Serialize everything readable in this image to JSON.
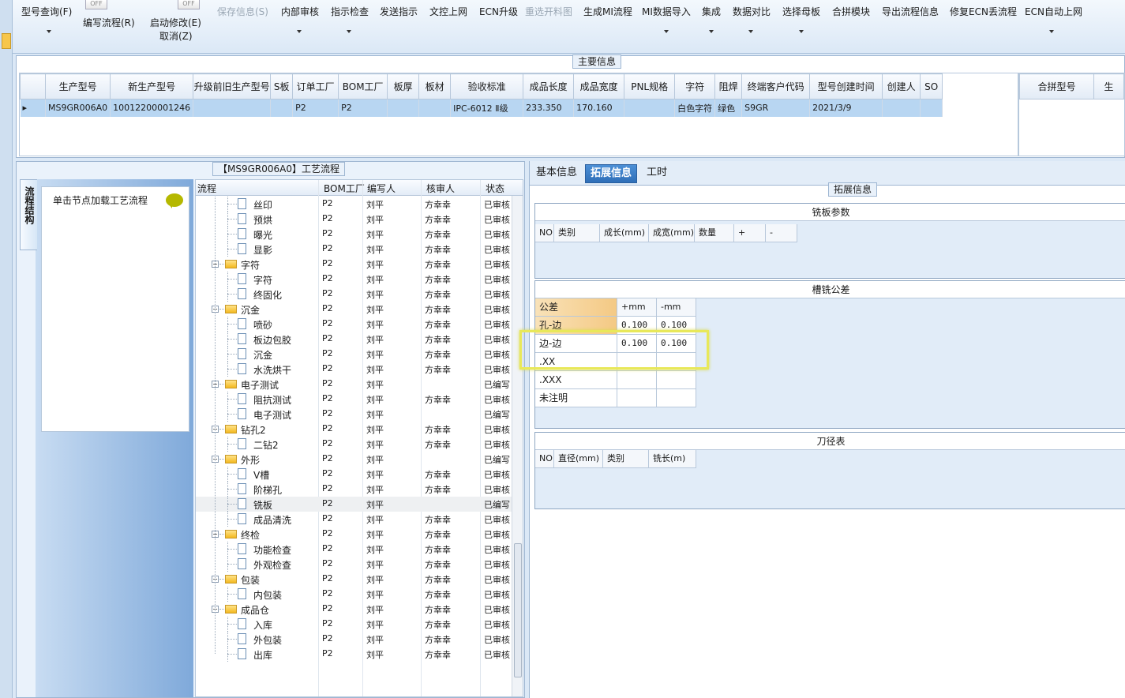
{
  "toolbar": {
    "items": [
      {
        "label": "型号查询(F)",
        "enabled": true,
        "dropdown": true
      },
      {
        "label": "编写流程(R)",
        "enabled": true,
        "toggle": "OFF"
      },
      {
        "label": "启动修改(E)",
        "enabled": true,
        "toggle": "OFF"
      },
      {
        "label": "取消(Z)",
        "enabled": true
      },
      {
        "label": "保存信息(S)",
        "enabled": false
      },
      {
        "label": "内部审核",
        "enabled": true,
        "dropdown": true
      },
      {
        "label": "指示检查",
        "enabled": true,
        "dropdown": true
      },
      {
        "label": "发送指示",
        "enabled": true
      },
      {
        "label": "文控上网",
        "enabled": true
      },
      {
        "label": "ECN升级",
        "enabled": true
      },
      {
        "label": "重选开料图",
        "enabled": false
      },
      {
        "label": "生成MI流程",
        "enabled": true
      },
      {
        "label": "MI数据导入",
        "enabled": true,
        "dropdown": true
      },
      {
        "label": "集成",
        "enabled": true,
        "dropdown": true
      },
      {
        "label": "数据对比",
        "enabled": true,
        "dropdown": true
      },
      {
        "label": "选择母板",
        "enabled": true,
        "dropdown": true
      },
      {
        "label": "合拼模块",
        "enabled": true
      },
      {
        "label": "导出流程信息",
        "enabled": true
      },
      {
        "label": "修复ECN丢流程",
        "enabled": true
      },
      {
        "label": "ECN自动上网",
        "enabled": true,
        "dropdown": true
      }
    ]
  },
  "main_info": {
    "title": "主要信息",
    "columns": [
      "生产型号",
      "新生产型号",
      "升级前旧生产型号",
      "S板",
      "订单工厂",
      "BOM工厂",
      "板厚",
      "板材",
      "验收标准",
      "成品长度",
      "成品宽度",
      "PNL规格",
      "字符",
      "阻焊",
      "终端客户代码",
      "型号创建时间",
      "创建人",
      "SO"
    ],
    "rows": [
      [
        "MS9GR006A0",
        "10012200001246",
        "",
        "",
        "P2",
        "P2",
        "",
        "",
        "IPC-6012 Ⅱ级",
        "233.350",
        "170.160",
        "",
        "白色字符",
        "绿色",
        "S9GR",
        "2021/3/9",
        "",
        ""
      ]
    ],
    "right_columns": [
      "合拼型号",
      "生"
    ]
  },
  "flow": {
    "title": "【MS9GR006A0】工艺流程",
    "side_tab": "流程结构",
    "node_hint": "单击节点加载工艺流程",
    "columns": [
      "流程",
      "BOM工厂",
      "编写人",
      "核审人",
      "状态"
    ],
    "rows": [
      {
        "name": "丝印",
        "type": "doc",
        "bom": "P2",
        "writer": "刘平",
        "reviewer": "方幸幸",
        "status": "已审核"
      },
      {
        "name": "预烘",
        "type": "doc",
        "bom": "P2",
        "writer": "刘平",
        "reviewer": "方幸幸",
        "status": "已审核"
      },
      {
        "name": "曝光",
        "type": "doc",
        "bom": "P2",
        "writer": "刘平",
        "reviewer": "方幸幸",
        "status": "已审核"
      },
      {
        "name": "显影",
        "type": "doc",
        "bom": "P2",
        "writer": "刘平",
        "reviewer": "方幸幸",
        "status": "已审核"
      },
      {
        "name": "字符",
        "type": "folder",
        "bom": "P2",
        "writer": "刘平",
        "reviewer": "方幸幸",
        "status": "已审核"
      },
      {
        "name": "字符",
        "type": "doc",
        "bom": "P2",
        "writer": "刘平",
        "reviewer": "方幸幸",
        "status": "已审核"
      },
      {
        "name": "终固化",
        "type": "doc",
        "bom": "P2",
        "writer": "刘平",
        "reviewer": "方幸幸",
        "status": "已审核"
      },
      {
        "name": "沉金",
        "type": "folder",
        "bom": "P2",
        "writer": "刘平",
        "reviewer": "方幸幸",
        "status": "已审核"
      },
      {
        "name": "喷砂",
        "type": "doc",
        "bom": "P2",
        "writer": "刘平",
        "reviewer": "方幸幸",
        "status": "已审核"
      },
      {
        "name": "板边包胶",
        "type": "doc",
        "bom": "P2",
        "writer": "刘平",
        "reviewer": "方幸幸",
        "status": "已审核"
      },
      {
        "name": "沉金",
        "type": "doc",
        "bom": "P2",
        "writer": "刘平",
        "reviewer": "方幸幸",
        "status": "已审核"
      },
      {
        "name": "水洗烘干",
        "type": "doc",
        "bom": "P2",
        "writer": "刘平",
        "reviewer": "方幸幸",
        "status": "已审核"
      },
      {
        "name": "电子测试",
        "type": "folder",
        "bom": "P2",
        "writer": "刘平",
        "reviewer": "",
        "status": "已编写"
      },
      {
        "name": "阻抗测试",
        "type": "doc",
        "bom": "P2",
        "writer": "刘平",
        "reviewer": "方幸幸",
        "status": "已审核"
      },
      {
        "name": "电子测试",
        "type": "doc",
        "bom": "P2",
        "writer": "刘平",
        "reviewer": "",
        "status": "已编写"
      },
      {
        "name": "钻孔2",
        "type": "folder",
        "bom": "P2",
        "writer": "刘平",
        "reviewer": "方幸幸",
        "status": "已审核"
      },
      {
        "name": "二钻2",
        "type": "doc",
        "bom": "P2",
        "writer": "刘平",
        "reviewer": "方幸幸",
        "status": "已审核"
      },
      {
        "name": "外形",
        "type": "folder",
        "bom": "P2",
        "writer": "刘平",
        "reviewer": "",
        "status": "已编写"
      },
      {
        "name": "V槽",
        "type": "doc",
        "bom": "P2",
        "writer": "刘平",
        "reviewer": "方幸幸",
        "status": "已审核"
      },
      {
        "name": "阶梯孔",
        "type": "doc",
        "bom": "P2",
        "writer": "刘平",
        "reviewer": "方幸幸",
        "status": "已审核"
      },
      {
        "name": "铣板",
        "type": "doc",
        "bom": "P2",
        "writer": "刘平",
        "reviewer": "",
        "status": "已编写",
        "selected": true
      },
      {
        "name": "成品清洗",
        "type": "doc",
        "bom": "P2",
        "writer": "刘平",
        "reviewer": "方幸幸",
        "status": "已审核"
      },
      {
        "name": "终检",
        "type": "folder",
        "bom": "P2",
        "writer": "刘平",
        "reviewer": "方幸幸",
        "status": "已审核"
      },
      {
        "name": "功能检查",
        "type": "doc",
        "bom": "P2",
        "writer": "刘平",
        "reviewer": "方幸幸",
        "status": "已审核"
      },
      {
        "name": "外观检查",
        "type": "doc",
        "bom": "P2",
        "writer": "刘平",
        "reviewer": "方幸幸",
        "status": "已审核"
      },
      {
        "name": "包装",
        "type": "folder",
        "bom": "P2",
        "writer": "刘平",
        "reviewer": "方幸幸",
        "status": "已审核"
      },
      {
        "name": "内包装",
        "type": "doc",
        "bom": "P2",
        "writer": "刘平",
        "reviewer": "方幸幸",
        "status": "已审核"
      },
      {
        "name": "成品仓",
        "type": "folder",
        "bom": "P2",
        "writer": "刘平",
        "reviewer": "方幸幸",
        "status": "已审核"
      },
      {
        "name": "入库",
        "type": "doc",
        "bom": "P2",
        "writer": "刘平",
        "reviewer": "方幸幸",
        "status": "已审核"
      },
      {
        "name": "外包装",
        "type": "doc",
        "bom": "P2",
        "writer": "刘平",
        "reviewer": "方幸幸",
        "status": "已审核"
      },
      {
        "name": "出库",
        "type": "doc",
        "bom": "P2",
        "writer": "刘平",
        "reviewer": "方幸幸",
        "status": "已审核"
      }
    ]
  },
  "detail": {
    "tabs": [
      "基本信息",
      "拓展信息",
      "工时"
    ],
    "active_tab": "拓展信息",
    "group_title": "拓展信息",
    "mill_params": {
      "title": "铣板参数",
      "columns": [
        "NO",
        "类别",
        "成长(mm)",
        "成宽(mm)",
        "数量",
        "+",
        "-"
      ]
    },
    "tolerance": {
      "title": "槽铣公差",
      "columns": [
        "公差",
        "+mm",
        "-mm"
      ],
      "rows": [
        [
          "孔-边",
          "0.100",
          "0.100"
        ],
        [
          "边-边",
          "0.100",
          "0.100"
        ],
        [
          ".XX",
          "",
          ""
        ],
        [
          ".XXX",
          "",
          ""
        ],
        [
          "未注明",
          "",
          ""
        ]
      ]
    },
    "tools": {
      "title": "刀径表",
      "columns": [
        "NO",
        "直径(mm)",
        "类别",
        "铣长(m)"
      ]
    }
  },
  "colors": {
    "selection": "#b8d6f2",
    "tab_active": "#2f6fb8",
    "highlight": "#e8e85a",
    "tolerance_header": "#f4c984"
  }
}
